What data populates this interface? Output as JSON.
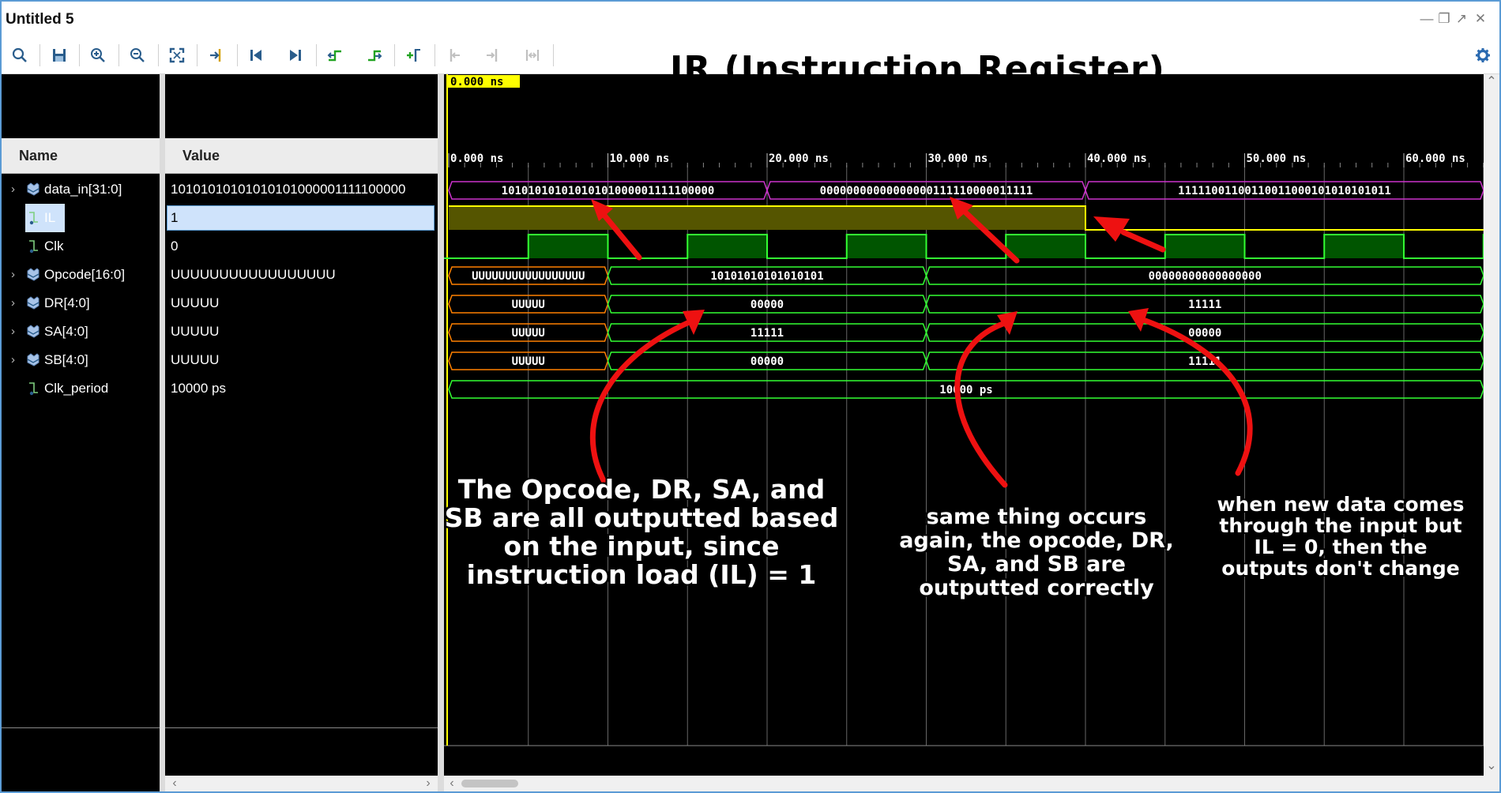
{
  "window": {
    "title": "Untitled 5"
  },
  "overlay_title": "IR (Instruction Register)",
  "toolbar": {
    "buttons": [
      {
        "name": "search-icon"
      },
      {
        "name": "save-icon"
      },
      {
        "name": "zoom-in-icon"
      },
      {
        "name": "zoom-out-icon"
      },
      {
        "name": "zoom-fit-icon"
      },
      {
        "name": "go-to-cursor-icon"
      },
      {
        "name": "go-to-start-icon"
      },
      {
        "name": "go-to-end-icon"
      },
      {
        "name": "previous-transition-icon"
      },
      {
        "name": "next-transition-icon"
      },
      {
        "name": "add-marker-icon"
      },
      {
        "name": "previous-marker-icon"
      },
      {
        "name": "next-marker-icon"
      },
      {
        "name": "swap-cursors-icon"
      },
      {
        "name": "settings-gear-icon"
      }
    ]
  },
  "columns": {
    "name": "Name",
    "value": "Value"
  },
  "signals": [
    {
      "name": "data_in[31:0]",
      "value": "10101010101010101000001111100000",
      "icon": "bus-icon",
      "expandable": true
    },
    {
      "name": "IL",
      "value": "1",
      "icon": "bit-icon",
      "expandable": false,
      "selected": true
    },
    {
      "name": "Clk",
      "value": "0",
      "icon": "bit-icon",
      "expandable": false
    },
    {
      "name": "Opcode[16:0]",
      "value": "UUUUUUUUUUUUUUUUU",
      "icon": "bus-icon",
      "expandable": true
    },
    {
      "name": "DR[4:0]",
      "value": "UUUUU",
      "icon": "bus-icon",
      "expandable": true
    },
    {
      "name": "SA[4:0]",
      "value": "UUUUU",
      "icon": "bus-icon",
      "expandable": true
    },
    {
      "name": "SB[4:0]",
      "value": "UUUUU",
      "icon": "bus-icon",
      "expandable": true
    },
    {
      "name": "Clk_period",
      "value": "10000 ps",
      "icon": "bit-icon",
      "expandable": false
    }
  ],
  "cursor": {
    "label": "0.000 ns",
    "color": "#ffff00"
  },
  "timeline": {
    "ticks": [
      "0.000 ns",
      "10.000 ns",
      "20.000 ns",
      "30.000 ns",
      "40.000 ns",
      "50.000 ns",
      "60.000 ns"
    ],
    "visible_range_ns": [
      0,
      66
    ]
  },
  "waves": {
    "data_in": [
      {
        "start": 0,
        "end": 20,
        "label": "10101010101010101000001111100000"
      },
      {
        "start": 20,
        "end": 40,
        "label": "00000000000000000111110000011111"
      },
      {
        "start": 40,
        "end": 66,
        "label": "11111001100110011000101010101011"
      }
    ],
    "IL": {
      "high_until_ns": 40
    },
    "Clk": {
      "period_ns": 10,
      "high_first_ns": 5
    },
    "Opcode": [
      {
        "start": 0,
        "end": 10,
        "label": "UUUUUUUUUUUUUUUUU",
        "undefined": true
      },
      {
        "start": 10,
        "end": 30,
        "label": "10101010101010101"
      },
      {
        "start": 30,
        "end": 66,
        "label": "00000000000000000"
      }
    ],
    "DR": [
      {
        "start": 0,
        "end": 10,
        "label": "UUUUU",
        "undefined": true
      },
      {
        "start": 10,
        "end": 30,
        "label": "00000"
      },
      {
        "start": 30,
        "end": 66,
        "label": "11111"
      }
    ],
    "SA": [
      {
        "start": 0,
        "end": 10,
        "label": "UUUUU",
        "undefined": true
      },
      {
        "start": 10,
        "end": 30,
        "label": "11111"
      },
      {
        "start": 30,
        "end": 66,
        "label": "00000"
      }
    ],
    "SB": [
      {
        "start": 0,
        "end": 10,
        "label": "UUUUU",
        "undefined": true
      },
      {
        "start": 10,
        "end": 30,
        "label": "00000"
      },
      {
        "start": 30,
        "end": 66,
        "label": "11111"
      }
    ],
    "Clk_period": [
      {
        "start": 0,
        "end": 66,
        "label": "10000 ps"
      }
    ]
  },
  "colors": {
    "bus": "#cc33cc",
    "signal": "#33ff33",
    "undefined": "#ff8000",
    "il": "#ffff00",
    "il_fill": "#555500",
    "clk_fill": "#005500",
    "grid": "#666666",
    "arrow": "#ee1111"
  },
  "annotations": [
    {
      "text": "The Opcode, DR, SA, and SB are all outputted based on the input, since instruction load (IL) = 1"
    },
    {
      "text": "same thing occurs again, the opcode, DR, SA, and SB are outputted correctly"
    },
    {
      "text": "when new data comes through the input but IL = 0, then the outputs don't change"
    }
  ]
}
